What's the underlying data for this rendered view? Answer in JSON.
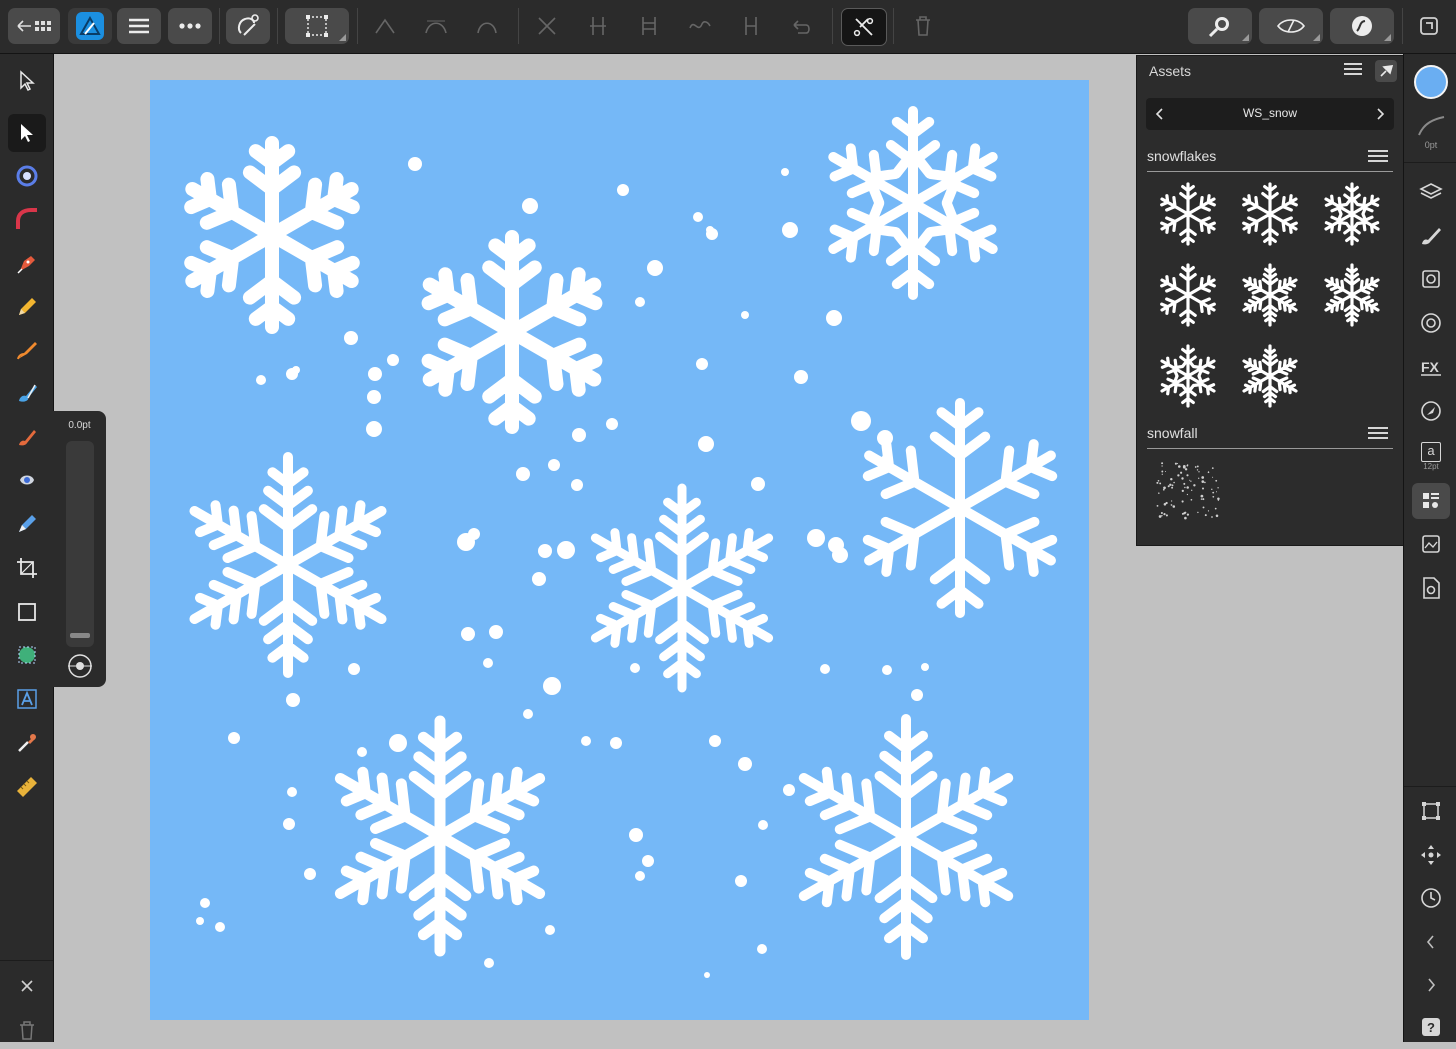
{
  "app": {
    "name": "Affinity Designer"
  },
  "stroke_width_label": "0.0pt",
  "color_panel": {
    "fill_color": "#6aaef2",
    "stroke_label": "0pt"
  },
  "text_tool": {
    "size_label": "12pt",
    "glyph": "a"
  },
  "assets_panel": {
    "title": "Assets",
    "set_name": "WS_snow",
    "categories": [
      {
        "name": "snowflakes",
        "item_count": 8
      },
      {
        "name": "snowfall",
        "item_count": 1
      }
    ]
  },
  "canvas": {
    "background": "#75b8f7",
    "flake_color": "#ffffff"
  },
  "icons": {
    "top": [
      "back-to-gallery-icon",
      "designer-persona-icon",
      "document-menu-icon",
      "more-icon",
      "snapping-icon",
      "transform-icon",
      "node-sharp-icon",
      "node-smooth-icon",
      "node-smart-icon",
      "break-curve-icon",
      "align-nodes-icon",
      "distribute-nodes-icon",
      "convert-icon",
      "reverse-curve-icon",
      "close-curve-icon",
      "contour-icon",
      "delete-icon",
      "zoom-icon",
      "view-mode-icon",
      "edit-mode-icon",
      "fullscreen-icon"
    ],
    "left": [
      "move-tool-icon",
      "node-tool-icon",
      "point-transform-icon",
      "corner-tool-icon",
      "pen-tool-icon",
      "pencil-tool-icon",
      "vector-brush-icon",
      "fill-tool-icon",
      "paint-brush-icon",
      "erase-brush-icon",
      "crop-tool-icon",
      "rectangle-tool-icon",
      "shape-tool-icon",
      "text-tool-icon",
      "color-picker-icon",
      "measure-tool-icon"
    ],
    "right": [
      "color-swatch-icon",
      "stroke-icon",
      "layers-icon",
      "brushes-icon",
      "styles-icon",
      "appearance-icon",
      "effects-icon",
      "navigator-icon",
      "text-icon",
      "assets-icon",
      "stock-icon",
      "document-settings-icon",
      "transform-studio-icon",
      "move-studio-icon",
      "history-icon",
      "collapse-left-icon",
      "collapse-right-icon",
      "help-icon"
    ]
  }
}
